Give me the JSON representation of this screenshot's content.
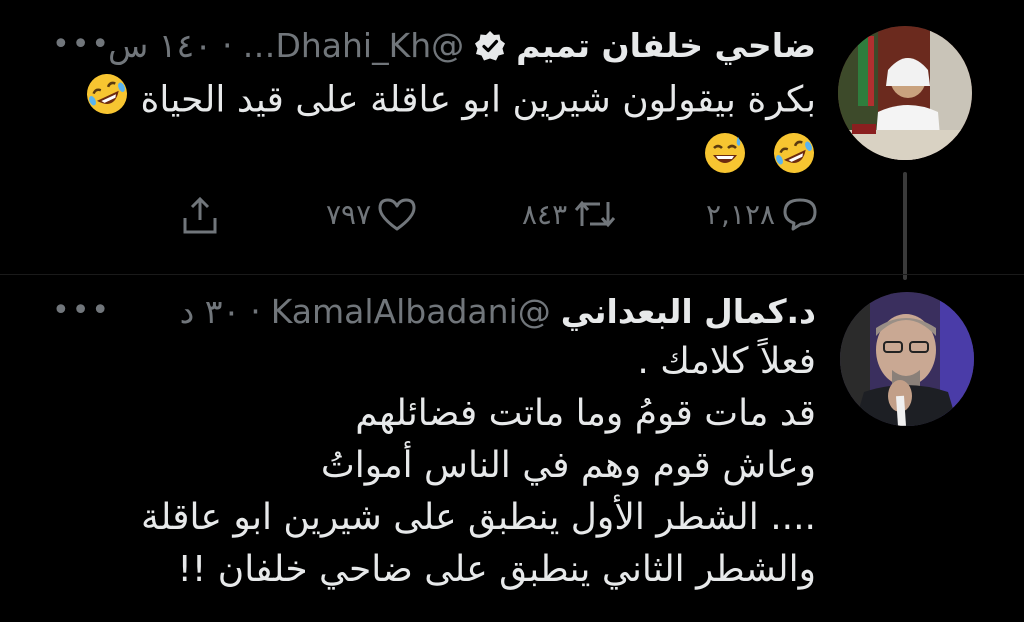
{
  "tweet1": {
    "display_name": "ضاحي خلفان تميم",
    "handle": "@Dhahi_Kh…",
    "time": "١٤٠ س",
    "text_lines": [
      "بكرة بيقولون شيرين ابو عاقلة على قيد الحياة"
    ],
    "emojis_line1": [
      "rolling-on-floor-laughing"
    ],
    "emojis_line2": [
      "rolling-on-floor-laughing",
      "grinning-sweat"
    ],
    "replies": "٢,١٢٨",
    "retweets": "٨٤٣",
    "likes": "٧٩٧"
  },
  "tweet2": {
    "display_name": "د.كمال البعداني",
    "handle": "@KamalAlbadani",
    "time": "٣٠ د",
    "text_lines": [
      "فعلاً كلامك .",
      "قد مات قومُ وما ماتت فضائلهم",
      "وعاش قوم وهم في الناس أمواتُ",
      ".... الشطر الأول ينطبق على شيرين ابو عاقلة",
      "والشطر الثاني ينطبق على ضاحي خلفان  !!"
    ]
  },
  "separator": "·",
  "colors": {
    "background": "#000000",
    "text": "#e7e9ea",
    "muted": "#71767b",
    "verified": "#e7e9ea"
  }
}
